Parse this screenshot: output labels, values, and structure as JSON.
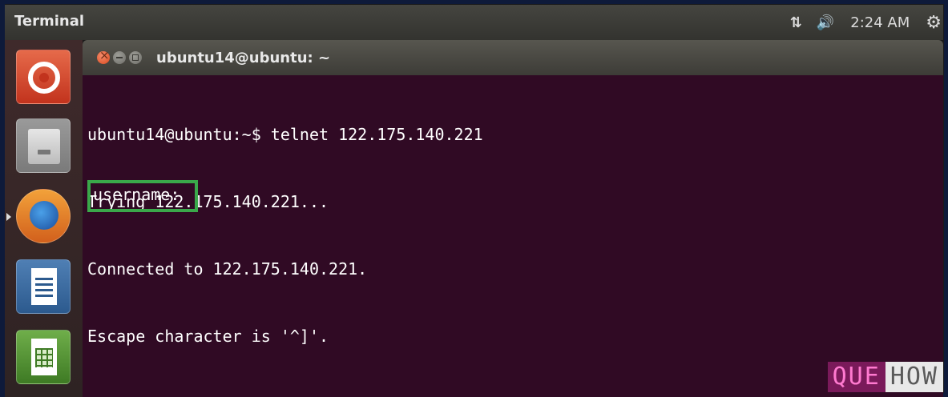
{
  "top_panel": {
    "title": "Terminal",
    "network_icon": "⇅",
    "volume_icon": "🔊",
    "time": "2:24 AM",
    "settings_icon": "⚙"
  },
  "launcher": {
    "items": [
      {
        "name": "ubuntu-dash",
        "icon": "ubuntu-logo-icon"
      },
      {
        "name": "files",
        "icon": "file-cabinet-icon"
      },
      {
        "name": "firefox",
        "icon": "firefox-icon"
      },
      {
        "name": "libreoffice-writer",
        "icon": "writer-icon"
      },
      {
        "name": "libreoffice-calc",
        "icon": "calc-icon"
      }
    ]
  },
  "terminal": {
    "window_title": "ubuntu14@ubuntu: ~",
    "lines": [
      "ubuntu14@ubuntu:~$ telnet 122.175.140.221",
      "Trying 122.175.140.221...",
      "Connected to 122.175.140.221.",
      "Escape character is '^]'."
    ],
    "prompt": "username:"
  },
  "watermark": {
    "part_a": "QUE",
    "part_b": "HOW"
  },
  "colors": {
    "terminal_bg": "#300a24",
    "highlight_box": "#3aa84a",
    "panel_bg": "#3c3b37"
  }
}
